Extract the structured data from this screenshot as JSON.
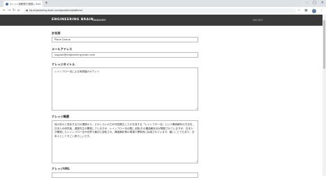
{
  "browser": {
    "tab_title": "ナレッジ投稿受付(登録) | Engineeri...",
    "tab_close": "×",
    "new_tab": "+",
    "url": "kq.engineering-brain.com/question/platform/",
    "window_controls": [
      "–",
      "□",
      "×"
    ],
    "nav": [
      "←",
      "→",
      "↻",
      "⌂"
    ]
  },
  "site": {
    "brand": "ENGINEERING BRAIN",
    "brand_sub": "INQUIRY",
    "login": "LOG OUT"
  },
  "form": {
    "name_label": "お名前",
    "name_value": "Plane Queue",
    "email_label": "メールアドレス",
    "email_value": "support@engineering-brain.com",
    "title_label": "ナレッジタイトル",
    "title_value": "レインフロー法による両振幅のカウント",
    "summary_label": "ナレッジ概要",
    "summary_value": "独々刻々と変化する力の遷移から、どのくらいの力が何回発生したかを見する「レインフロー法」という構造解析の方法を、日本人の研究者、遠藤先生が開発していますが、レインフロー法の間に点数(その構造解析法が開発されていますが、日本人が開発したレインフロー法が世界で最初に認知され、構造解析等の現場で標準的に採用されています。厳いことでもあり、日本人としてすごく誇らしいです。",
    "next_label": "ナレッジURL"
  },
  "colors": {
    "site_nav_bg": "#3a3a3a",
    "tabbar_bg": "#dee1e6"
  }
}
